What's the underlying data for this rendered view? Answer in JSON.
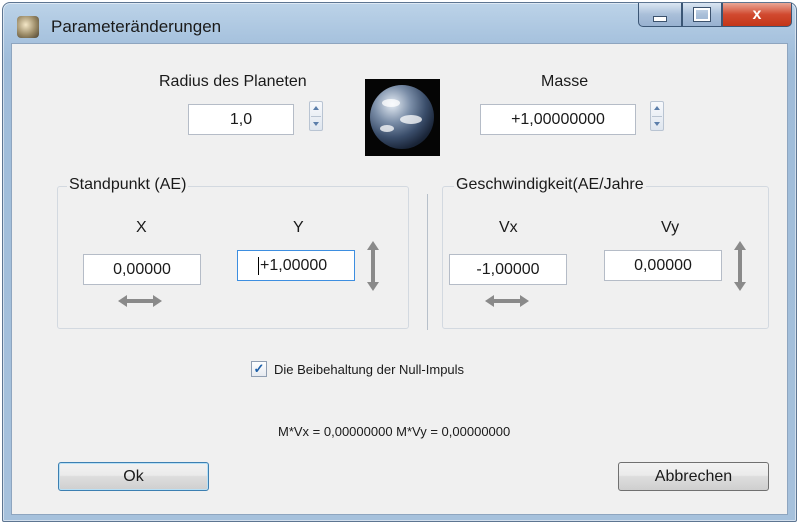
{
  "window": {
    "title": "Parameteränderungen",
    "close_glyph": "x"
  },
  "planet": {
    "radius_label": "Radius des Planeten",
    "radius_value": "1,0",
    "mass_label": "Masse",
    "mass_value": "+1,00000000",
    "image_icon": "earth-globe-icon"
  },
  "position": {
    "group_title": "Standpunkt (AE)",
    "x_label": "X",
    "y_label": "Y",
    "x_value": "0,00000",
    "y_value": "+1,00000"
  },
  "velocity": {
    "group_title": "Geschwindigkeit(AE/Jahre",
    "vx_label": "Vx",
    "vy_label": "Vy",
    "vx_value": "-1,00000",
    "vy_value": "0,00000"
  },
  "options": {
    "zero_momentum_label": "Die Beibehaltung der Null-Impuls",
    "zero_momentum_checked": true,
    "check_glyph": "✓"
  },
  "momentum_readout": "M*Vx = 0,00000000 M*Vy = 0,00000000",
  "buttons": {
    "ok": "Ok",
    "cancel": "Abbrechen"
  },
  "colors": {
    "frame": "#a9c4df",
    "client": "#f0f0f0",
    "close_button": "#d1492f",
    "focus_border": "#3d8ee0"
  }
}
